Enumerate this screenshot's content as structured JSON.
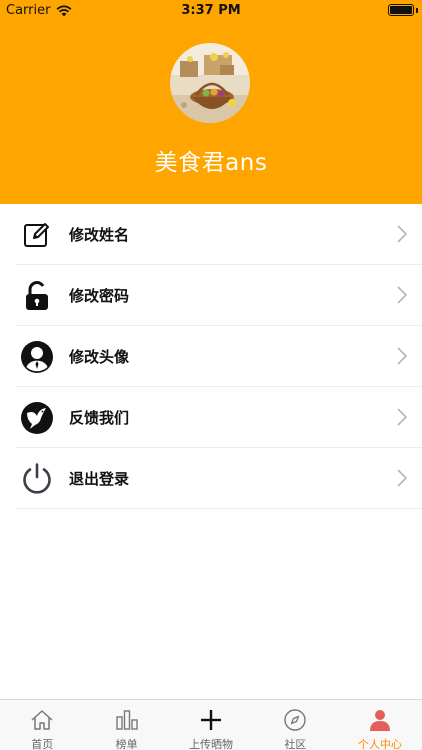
{
  "status_bar": {
    "carrier": "Carrier",
    "time": "3:37 PM"
  },
  "profile": {
    "username": "美食君ans",
    "header_color": "#FFA500"
  },
  "menu": [
    {
      "label": "修改姓名",
      "icon": "edit-icon"
    },
    {
      "label": "修改密码",
      "icon": "lock-icon"
    },
    {
      "label": "修改头像",
      "icon": "user-icon"
    },
    {
      "label": "反馈我们",
      "icon": "dove-icon"
    },
    {
      "label": "退出登录",
      "icon": "power-icon"
    }
  ],
  "tabs": [
    {
      "label": "首页",
      "icon": "home-icon"
    },
    {
      "label": "榜单",
      "icon": "bar-chart-icon"
    },
    {
      "label": "上传晒物",
      "icon": "plus-icon"
    },
    {
      "label": "社区",
      "icon": "compass-icon"
    },
    {
      "label": "个人中心",
      "icon": "person-icon",
      "active": true
    }
  ],
  "colors": {
    "accent": "#FF8C00",
    "active_tab_icon": "#E2605A"
  }
}
